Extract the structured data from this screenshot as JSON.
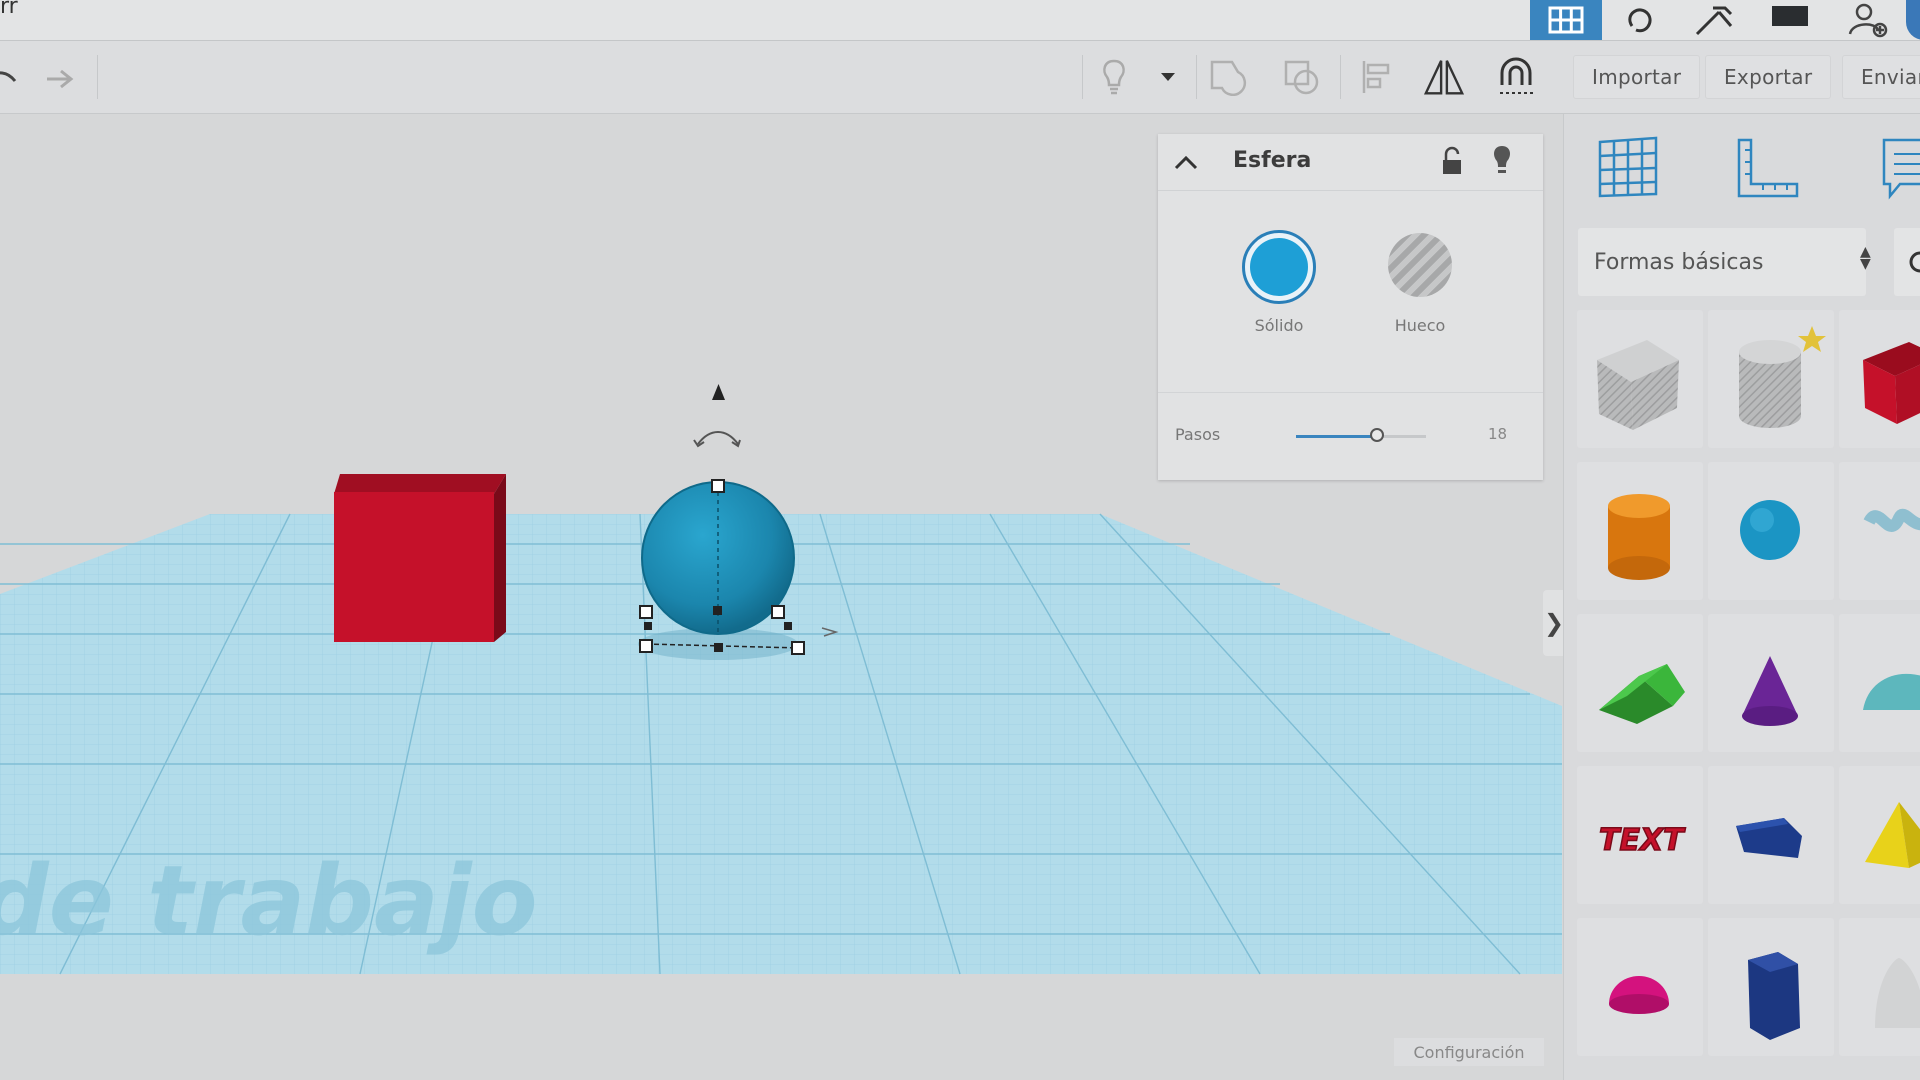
{
  "app": {
    "title_fragment": "rr"
  },
  "top_nav": {
    "items": [
      {
        "name": "3d-design",
        "icon": "grid-icon",
        "active": true
      },
      {
        "name": "circuits",
        "icon": "circuit-icon"
      },
      {
        "name": "codeblocks",
        "icon": "tools-icon"
      },
      {
        "name": "lessons",
        "icon": "lessons-icon"
      },
      {
        "name": "add-user",
        "icon": "add-user-icon"
      }
    ]
  },
  "toolbar": {
    "import_label": "Importar",
    "export_label": "Exportar",
    "send_label": "Enviar"
  },
  "inspector": {
    "title": "Esfera",
    "solid_label": "Sólido",
    "hole_label": "Hueco",
    "solid_color": "#1e9fd6",
    "steps_label": "Pasos",
    "steps_value": "18",
    "steps_fraction": 0.62
  },
  "workplane": {
    "watermark": "de trabajo",
    "grid_color": "#7fc3dd",
    "objects": [
      {
        "name": "Caja",
        "color": "#c5112a"
      },
      {
        "name": "Esfera",
        "color": "#1a8fb4",
        "selected": true
      }
    ]
  },
  "side_panel": {
    "category": "Formas básicas",
    "shapes": [
      [
        "Caja hueca",
        "Cilindro hueco",
        "Caja"
      ],
      [
        "Cilindro",
        "Esfera",
        "Garabato"
      ],
      [
        "Techo",
        "Cono",
        "Techo curvo"
      ],
      [
        "Texto",
        "Polígono",
        "Pirámide"
      ],
      [
        "Semiesfera",
        "Prisma poligonal",
        "Paraboloide"
      ]
    ],
    "text_shape_label": "TEXT"
  },
  "footer": {
    "settings_label": "Configuración"
  }
}
